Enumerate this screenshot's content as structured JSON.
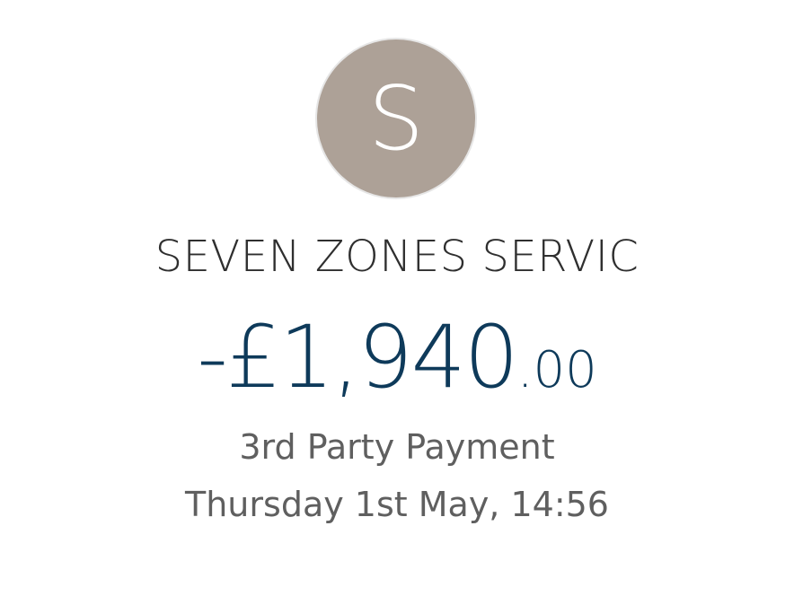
{
  "avatar": {
    "letter": "S",
    "color": "#ada197"
  },
  "transaction": {
    "merchant": "SEVEN ZONES SERVIC",
    "amount_main": "-£1,940",
    "amount_pence": ".00",
    "amount_color": "#0e3a5a",
    "type": "3rd Party Payment",
    "datetime": "Thursday 1st May, 14:56"
  }
}
